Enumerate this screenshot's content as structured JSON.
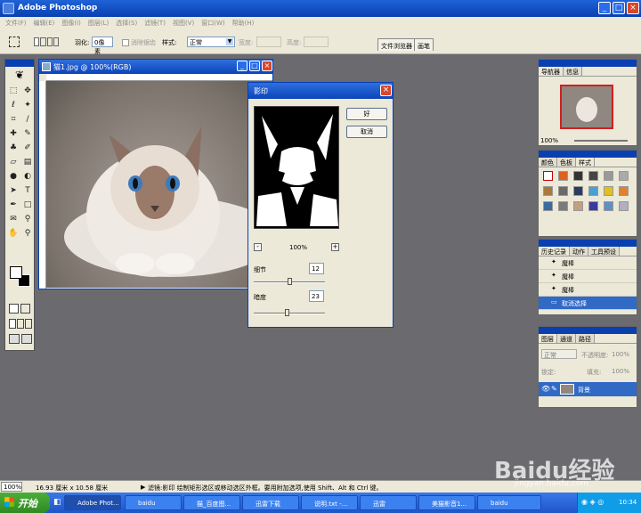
{
  "app": {
    "title": "Adobe Photoshop"
  },
  "menu": [
    "文件(F)",
    "编辑(E)",
    "图像(I)",
    "图层(L)",
    "选择(S)",
    "滤镜(T)",
    "视图(V)",
    "窗口(W)",
    "帮助(H)"
  ],
  "options": {
    "feather_label": "羽化:",
    "feather_value": "0像素",
    "antialias_label": "消除锯齿",
    "style_label": "样式:",
    "style_value": "正常",
    "width_label": "宽度:",
    "height_label": "高度:",
    "tab1": "文件浏览器",
    "tab2": "画笔"
  },
  "document": {
    "title": "猫1.jpg @ 100%(RGB)"
  },
  "dialog": {
    "title": "影印",
    "ok": "好",
    "cancel": "取消",
    "zoom": "100%",
    "zoom_minus": "-",
    "zoom_plus": "+",
    "detail_label": "细节",
    "detail_value": "12",
    "darkness_label": "暗度",
    "darkness_value": "23",
    "detail_level": 0.5,
    "darkness_level": 0.46
  },
  "navigator": {
    "tabs": [
      "导航器",
      "信息"
    ],
    "zoom": "100%"
  },
  "swatches": {
    "tabs": [
      "颜色",
      "色板",
      "样式"
    ]
  },
  "history": {
    "tabs": [
      "历史记录",
      "动作",
      "工具预设"
    ],
    "items": [
      "魔棒",
      "魔棒",
      "魔棒",
      "取消选择"
    ]
  },
  "layers": {
    "tabs": [
      "图层",
      "通道",
      "路径"
    ],
    "mode": "正常",
    "opacity_label": "不透明度:",
    "opacity": "100%",
    "lock_label": "锁定:",
    "fill_label": "填充:",
    "fill": "100%",
    "layer_name": "背景"
  },
  "status": {
    "zoom": "100%",
    "size": "16.93 厘米 x 10.58 厘米",
    "hint": "滤镜:影印  绘制矩形选区或移动选区外框。要用附加选项,使用 Shift、Alt 和 Ctrl 键。"
  },
  "taskbar": {
    "start": "开始",
    "tasks": [
      "Adobe Phot...",
      "baidu",
      "猫_百度图...",
      "迅雷下载",
      "说明.txt -...",
      "迅雷",
      "美猫影音1...",
      "baidu"
    ],
    "time": "10:34"
  },
  "watermark": {
    "brand": "Baidu经验",
    "url": "jingyan.baidu.com"
  },
  "colors": {
    "accent": "#0a3fb0",
    "selection": "#316ac5"
  }
}
